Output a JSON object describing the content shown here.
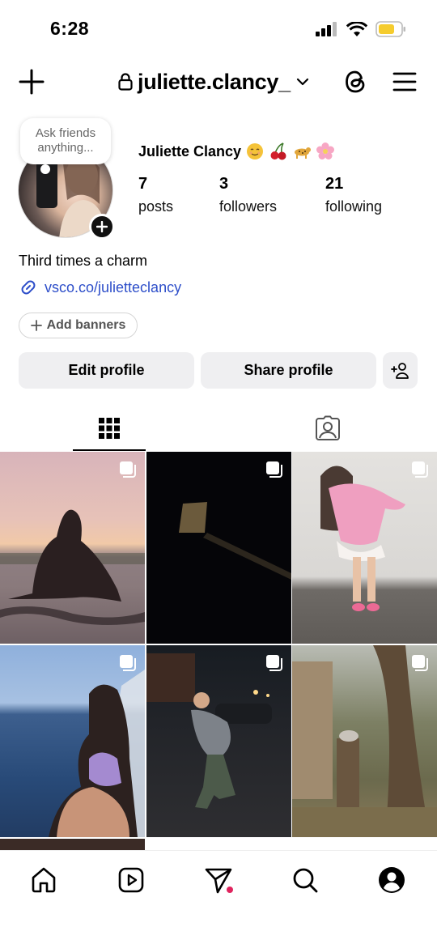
{
  "status_bar": {
    "time": "6:28"
  },
  "header": {
    "username": "juliette.clancy_"
  },
  "profile": {
    "note": "Ask friends anything...",
    "display_name": "Juliette Clancy",
    "stats": [
      {
        "value": "7",
        "label": "posts"
      },
      {
        "value": "3",
        "label": "followers"
      },
      {
        "value": "21",
        "label": "following"
      }
    ],
    "bio": "Third times a charm",
    "link": "vsco.co/julietteclancy",
    "add_banners": "Add banners",
    "edit_profile": "Edit profile",
    "share_profile": "Share profile"
  },
  "icons": {
    "create": "plus-icon",
    "lock": "lock-icon",
    "threads": "threads-icon",
    "menu": "hamburger-menu-icon",
    "grid": "grid-icon",
    "tagged": "tagged-person-icon",
    "home": "home-icon",
    "reels": "reels-icon",
    "messages": "paper-plane-icon",
    "search": "search-icon",
    "profile": "profile-icon"
  },
  "colors": {
    "link": "#2d4ec9",
    "notification_dot": "#e0245e",
    "button_bg": "#efeff1"
  }
}
